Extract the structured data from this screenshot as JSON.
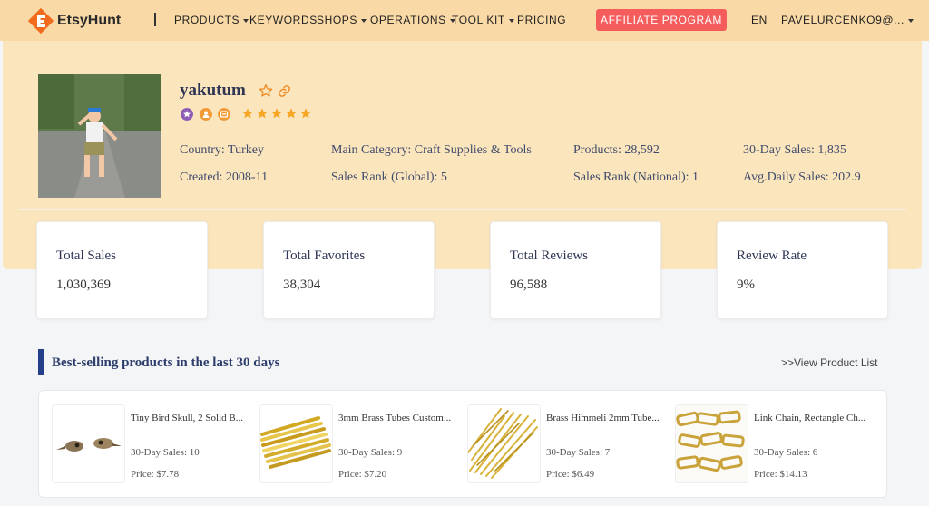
{
  "brand": {
    "name": "EtsyHunt"
  },
  "nav": {
    "items": [
      {
        "label": "PRODUCTS"
      },
      {
        "label": "KEYWORDS"
      },
      {
        "label": "SHOPS"
      },
      {
        "label": "OPERATIONS"
      },
      {
        "label": "TOOL KIT"
      },
      {
        "label": "PRICING"
      }
    ],
    "affiliate_label": "AFFILIATE PROGRAM",
    "language": "EN",
    "user": "PAVELURCENKO9@..."
  },
  "shop": {
    "name": "yakutum",
    "rating_stars": 5,
    "country": "Country: Turkey",
    "created": "Created: 2008-11",
    "main_category": "Main Category: Craft Supplies & Tools",
    "sales_rank_global": "Sales Rank (Global): 5",
    "products": "Products: 28,592",
    "sales_rank_national": "Sales Rank (National): 1",
    "sales_30d": "30-Day Sales: 1,835",
    "avg_daily_sales": "Avg.Daily Sales: 202.9"
  },
  "stats": [
    {
      "label": "Total Sales",
      "value": "1,030,369"
    },
    {
      "label": "Total Favorites",
      "value": "38,304"
    },
    {
      "label": "Total Reviews",
      "value": "96,588"
    },
    {
      "label": "Review Rate",
      "value": "9%"
    }
  ],
  "bestselling": {
    "title": "Best-selling products in the last 30 days",
    "view_link": ">>View Product List",
    "products": [
      {
        "name": "Tiny Bird Skull, 2 Solid B...",
        "sales": "30-Day Sales: 10",
        "price": "Price: $7.78"
      },
      {
        "name": "3mm Brass Tubes Custom...",
        "sales": "30-Day Sales: 9",
        "price": "Price: $7.20"
      },
      {
        "name": "Brass Himmeli 2mm Tube...",
        "sales": "30-Day Sales: 7",
        "price": "Price: $6.49"
      },
      {
        "name": "Link Chain, Rectangle Ch...",
        "sales": "30-Day Sales: 6",
        "price": "Price: $14.13"
      }
    ]
  },
  "colors": {
    "nav_bg": "#f9d9a6",
    "panel_bg": "#fae5bd",
    "accent_red": "#f55d5d",
    "title_navy": "#2f3553",
    "star_gold": "#f6a623",
    "badge_purple": "#8e5bb5",
    "badge_orange": "#f29a36",
    "section_bar": "#233f8a"
  }
}
